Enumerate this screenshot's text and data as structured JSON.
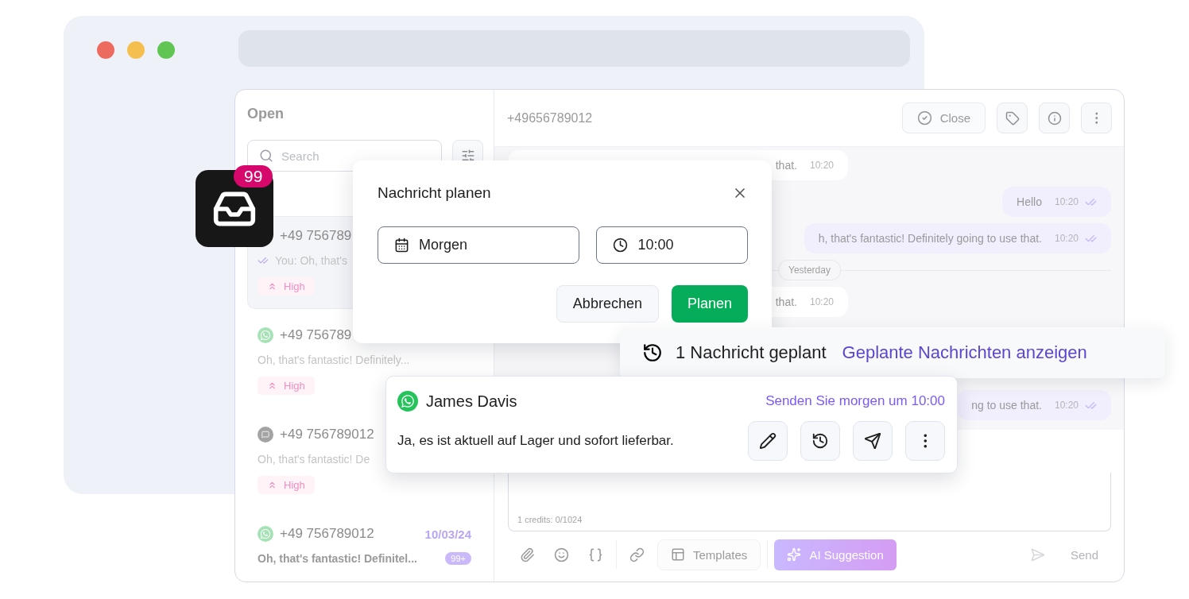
{
  "browser": {
    "traffic_lights": [
      {
        "color": "#ed6a5e"
      },
      {
        "color": "#f4bf4f"
      },
      {
        "color": "#61c554"
      }
    ]
  },
  "app_icon": {
    "badge": "99"
  },
  "sidebar": {
    "title": "Open",
    "search": {
      "placeholder": "Search"
    },
    "conversations": [
      {
        "selected": true,
        "phone": "+49 756789",
        "preview": "You: Oh, that's",
        "sent_by_me": true,
        "unread": false,
        "tag": "High"
      },
      {
        "selected": false,
        "kind": "whatsapp",
        "phone": "+49 756789",
        "preview": "Oh, that's fantastic! Definitely...",
        "sent_by_me": false,
        "unread": false,
        "tag": "High"
      },
      {
        "selected": false,
        "kind": "sms",
        "phone": "+49 756789012",
        "preview": "Oh, that's fantastic! De",
        "sent_by_me": false,
        "unread": false,
        "tag": "High"
      },
      {
        "selected": false,
        "kind": "whatsapp",
        "phone": "+49 756789012",
        "date": "10/03/24",
        "preview": "Oh, that's fantastic! Definitel...",
        "sent_by_me": false,
        "unread": true,
        "unread_count": "99+"
      }
    ]
  },
  "chat": {
    "contact": "+49656789012",
    "actions": [
      {
        "kind": "close",
        "label": "Close"
      },
      {
        "kind": "tag"
      },
      {
        "kind": "info"
      },
      {
        "kind": "more"
      }
    ],
    "messages": [
      {
        "kind": "incoming",
        "text": "that.",
        "time": "10:20"
      },
      {
        "kind": "outgoing",
        "text": "Hello",
        "time": "10:20",
        "read": true
      },
      {
        "kind": "outgoing",
        "text": "h, that's fantastic! Definitely going to use that.",
        "time": "10:20",
        "read": true
      },
      {
        "kind": "divider",
        "text": "Yesterday"
      },
      {
        "kind": "incoming",
        "text": "that.",
        "time": "10:20"
      },
      {
        "kind": "outgoing",
        "text": "ng to use that.",
        "time": "10:20",
        "read": true
      }
    ],
    "composer": {
      "credits": "1 credits: 0/1024"
    },
    "toolbar": [
      {
        "kind": "attach"
      },
      {
        "kind": "emoji"
      },
      {
        "kind": "variables"
      },
      {
        "kind": "separator"
      },
      {
        "kind": "link"
      },
      {
        "kind": "templates",
        "label": "Templates"
      },
      {
        "kind": "separator"
      },
      {
        "kind": "ai",
        "label": "AI Suggestion"
      },
      {
        "kind": "spacer"
      },
      {
        "kind": "schedule_send",
        "disabled": true
      },
      {
        "kind": "send",
        "label": "Send",
        "disabled": true
      }
    ]
  },
  "dialog": {
    "title": "Nachricht planen",
    "date": {
      "value": "Morgen"
    },
    "time": {
      "value": "10:00"
    },
    "buttons": [
      {
        "kind": "secondary",
        "label": "Abbrechen"
      },
      {
        "kind": "primary",
        "label": "Planen"
      }
    ]
  },
  "banner": {
    "text": "1 Nachricht geplant",
    "link": "Geplante Nachrichten anzeigen"
  },
  "scheduled_message": {
    "contact": "James Davis",
    "when": "Senden Sie morgen um 10:00",
    "text": "Ja, es ist aktuell auf Lager und sofort lieferbar.",
    "actions": [
      {
        "kind": "edit"
      },
      {
        "kind": "reschedule"
      },
      {
        "kind": "send"
      },
      {
        "kind": "more"
      }
    ]
  }
}
